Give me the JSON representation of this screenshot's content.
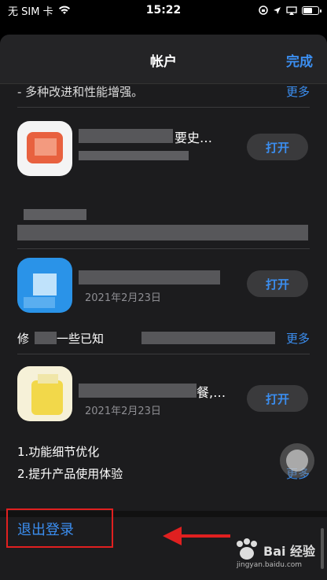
{
  "status": {
    "carrier": "无 SIM 卡",
    "time": "15:22"
  },
  "nav": {
    "title": "帐户",
    "done": "完成"
  },
  "updates": {
    "top_note": "- 多种改进和性能增强。",
    "more": "更多",
    "apps": [
      {
        "name": "要史…",
        "date": "",
        "open": "打开"
      },
      {
        "name": "",
        "date": "2021年2月23日",
        "open": "打开",
        "note": "修",
        "note2": "一些已知"
      },
      {
        "name": "餐,…",
        "date": "2021年2月23日",
        "open": "打开"
      }
    ],
    "notes3": [
      "1.功能细节优化",
      "2.提升产品使用体验"
    ]
  },
  "signout": "退出登录",
  "watermark": {
    "brand": "Bai 经验",
    "url": "jingyan.baidu.com"
  }
}
